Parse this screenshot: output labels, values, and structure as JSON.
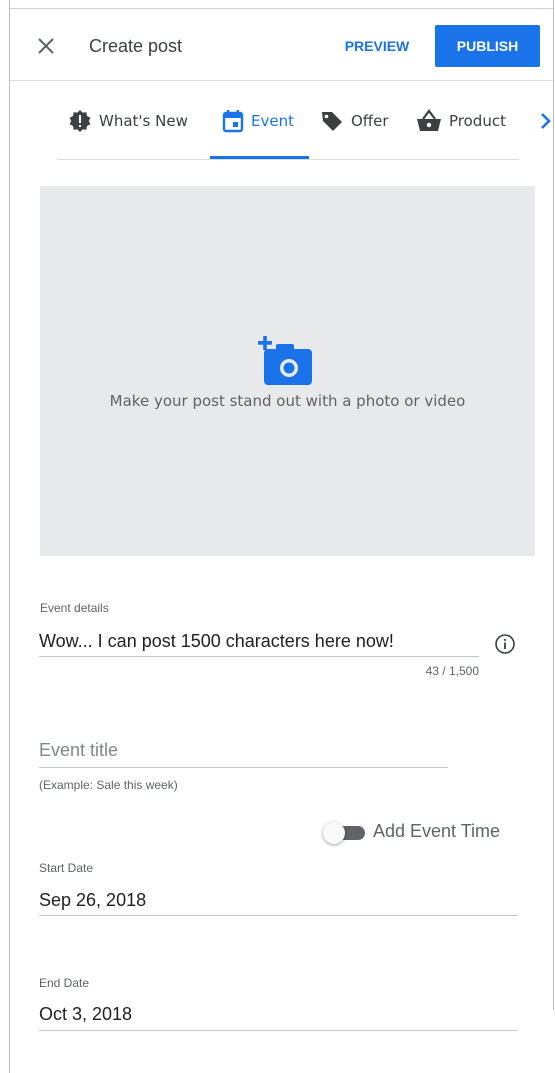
{
  "header": {
    "title": "Create post",
    "preview_label": "PREVIEW",
    "publish_label": "PUBLISH"
  },
  "tabs": [
    {
      "label": "What's New",
      "icon": "alert-badge-icon",
      "active": false
    },
    {
      "label": "Event",
      "icon": "calendar-icon",
      "active": true
    },
    {
      "label": "Offer",
      "icon": "tag-icon",
      "active": false
    },
    {
      "label": "Product",
      "icon": "shopping-basket-icon",
      "active": false
    }
  ],
  "media": {
    "caption": "Make your post stand out with a photo or video",
    "icon": "add-photo-icon"
  },
  "event_details": {
    "label": "Event details",
    "value": "Wow... I can post 1500 characters here now!",
    "counter": "43 / 1,500"
  },
  "event_title": {
    "placeholder": "Event title",
    "hint": "(Example: Sale this week)"
  },
  "add_event_time": {
    "label": "Add Event Time",
    "enabled": false
  },
  "start_date": {
    "label": "Start Date",
    "value": "Sep 26, 2018"
  },
  "end_date": {
    "label": "End Date",
    "value": "Oct 3, 2018"
  },
  "colors": {
    "accent": "#1a73e8",
    "photo_bg": "#e8e9eb",
    "icon_dark": "#3c4043"
  }
}
